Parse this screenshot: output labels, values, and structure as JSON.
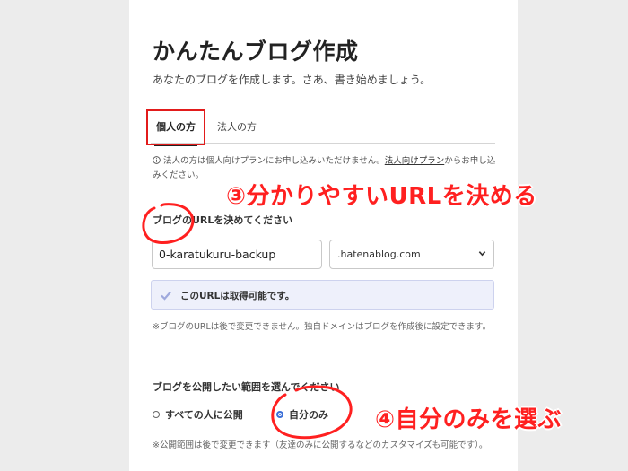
{
  "page": {
    "title": "かんたんブログ作成",
    "subtitle": "あなたのブログを作成します。さあ、書き始めましょう。"
  },
  "tabs": {
    "personal": "個人の方",
    "corporate": "法人の方"
  },
  "notice": {
    "icon": "info-icon",
    "text_before": "法人の方は個人向けプランにお申し込みいただけません。",
    "link": "法人向けプラン",
    "text_after": "からお申し込みください。"
  },
  "url_section": {
    "label": "ブログのURLを決めてください",
    "subdomain_value": "0-karatukuru-backup",
    "domain_selected": ".hatenablog.com",
    "availability": "このURLは取得可能です。",
    "hint": "※ブログのURLは後で変更できません。独自ドメインはブログを作成後に設定できます。"
  },
  "scope_section": {
    "label": "ブログを公開したい範囲を選んでください",
    "option_all": "すべての人に公開",
    "option_self": "自分のみ",
    "selected": "自分のみ",
    "hint": "※公開範囲は後で変更できます（友達のみに公開するなどのカスタマイズも可能です）。"
  },
  "annotations": {
    "step3": "③分かりやすいURLを決める",
    "step4": "④自分のみを選ぶ",
    "color": "#ff2020"
  }
}
